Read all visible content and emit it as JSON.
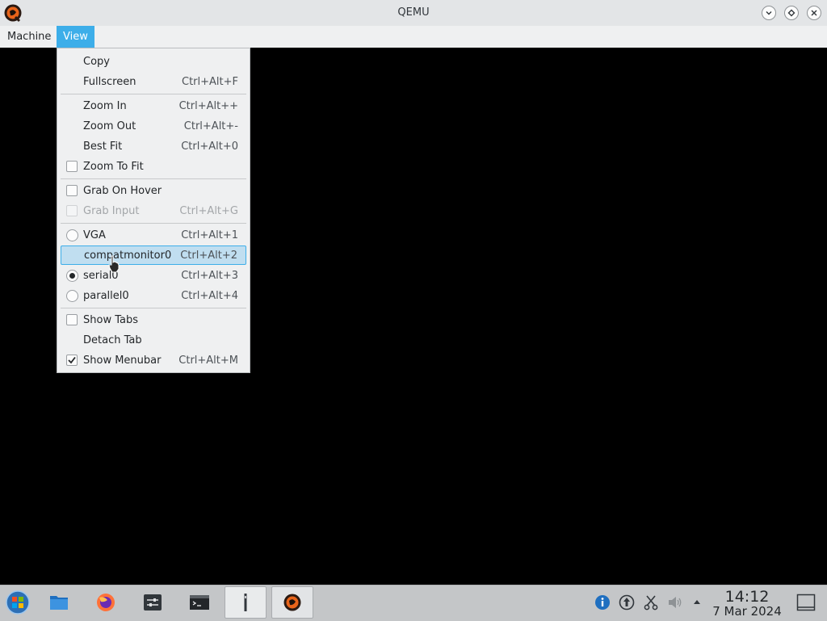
{
  "window": {
    "title": "QEMU",
    "buttons": [
      "minimize-icon",
      "maximize-icon",
      "close-icon"
    ]
  },
  "menubar": {
    "items": [
      {
        "label": "Machine",
        "active": false
      },
      {
        "label": "View",
        "active": true
      }
    ]
  },
  "view_menu": {
    "items": [
      {
        "label": "Copy",
        "shortcut": ""
      },
      {
        "label": "Fullscreen",
        "shortcut": "Ctrl+Alt+F"
      },
      {
        "label": "Zoom In",
        "shortcut": "Ctrl+Alt++"
      },
      {
        "label": "Zoom Out",
        "shortcut": "Ctrl+Alt+-"
      },
      {
        "label": "Best Fit",
        "shortcut": "Ctrl+Alt+0"
      },
      {
        "label": "Zoom To Fit",
        "shortcut": "",
        "checkbox": true,
        "checked": false
      },
      {
        "label": "Grab On Hover",
        "shortcut": "",
        "checkbox": true,
        "checked": false
      },
      {
        "label": "Grab Input",
        "shortcut": "Ctrl+Alt+G",
        "checkbox": true,
        "checked": false,
        "disabled": true
      },
      {
        "label": "VGA",
        "shortcut": "Ctrl+Alt+1",
        "radio": true,
        "selected": false
      },
      {
        "label": "compatmonitor0",
        "shortcut": "Ctrl+Alt+2",
        "highlighted": true
      },
      {
        "label": "serial0",
        "shortcut": "Ctrl+Alt+3",
        "radio": true,
        "selected": true
      },
      {
        "label": "parallel0",
        "shortcut": "Ctrl+Alt+4",
        "radio": true,
        "selected": false
      },
      {
        "label": "Show Tabs",
        "shortcut": "",
        "checkbox": true,
        "checked": false
      },
      {
        "label": "Detach Tab",
        "shortcut": ""
      },
      {
        "label": "Show Menubar",
        "shortcut": "Ctrl+Alt+M",
        "checkbox": true,
        "checked": true
      }
    ]
  },
  "taskbar": {
    "launchers": [
      "start-menu-icon",
      "file-manager-icon",
      "firefox-icon",
      "system-settings-icon",
      "terminal-icon",
      "qemu-disk-icon",
      "qemu-window-icon"
    ],
    "tray": [
      "info-icon",
      "update-icon",
      "scissors-icon",
      "volume-icon",
      "tray-expand-icon"
    ],
    "clock": {
      "time": "14:12",
      "date": "7 Mar 2024"
    },
    "show_desktop": "show-desktop-icon"
  },
  "colors": {
    "accent": "#3daee9",
    "highlight": "#c0def0",
    "menu_bg": "#eff0f1",
    "guest_screen": "#000000"
  }
}
